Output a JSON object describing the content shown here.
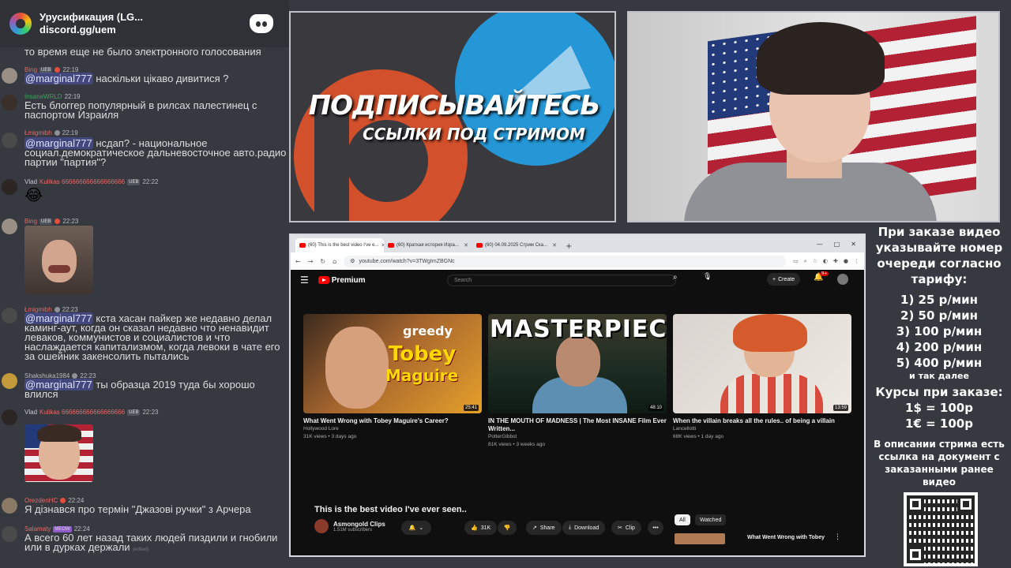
{
  "discord": {
    "server_name": "Урусификация (LG...",
    "invite": "discord.gg/uem",
    "messages": [
      {
        "kind": "text",
        "text": "то время еще не было электронного голосования"
      },
      {
        "kind": "msg",
        "user": "Bing",
        "user_color": "#e86a6a",
        "time": "22:19",
        "badge": "UEB",
        "mention": "@marginal777",
        "text": " наскільки цікаво дивитися ?"
      },
      {
        "kind": "msg",
        "user": "InsaneWRLD",
        "user_color": "#3ba55c",
        "time": "22:19",
        "text": "Есть блоггер популярный в рилсах палестинец с паспортом Израиля"
      },
      {
        "kind": "msg",
        "user": "Łmigmibh",
        "user_color": "#e86a6a",
        "time": "22:19",
        "mention": "@marginal777",
        "text": " нсдап? - национальное социал.демократическое дальневосточное авто.радио партии \"партия\"?"
      },
      {
        "kind": "msg",
        "user": "Vlad",
        "user_color": "#c9cdd2",
        "user_suffix": "Kulikas 666666666666666666",
        "time": "22:22",
        "badge": "UEB",
        "emoji": "😂"
      },
      {
        "kind": "msg",
        "user": "Bing",
        "user_color": "#e86a6a",
        "time": "22:23",
        "badge": "UEB",
        "image": "selfie-photo"
      },
      {
        "kind": "msg",
        "user": "Łmigmibh",
        "user_color": "#e86a6a",
        "time": "22:23",
        "mention": "@marginal777",
        "text": " кста хасан пайкер же недавно делал каминг-аут, когда он сказал недавно что ненавидит леваков, коммунистов и социалистов и что наслаждается капитализмом, когда левоки в чате его за ошейник закенсолить пытались"
      },
      {
        "kind": "msg",
        "user": "Shakshuka1984",
        "user_color": "#b9bbbe",
        "time": "22:23",
        "mention": "@marginal777",
        "text": " ты образца 2019 туда бы хорошо влился"
      },
      {
        "kind": "msg",
        "user": "Vlad",
        "user_color": "#c9cdd2",
        "user_suffix": "Kulikas 666666666666666666",
        "time": "22:23",
        "badge": "UEB",
        "image": "flag-selfie-photo"
      },
      {
        "kind": "msg",
        "user": "OrezdenHC",
        "user_color": "#e86a6a",
        "time": "22:24",
        "text": "Я дізнався про термін \"Джазові ручки\" з Арчера"
      },
      {
        "kind": "msg",
        "user": "Salamaty",
        "user_color": "#e86a6a",
        "time": "22:24",
        "badge": "MEOW",
        "text": "А всего 60 лет назад таких людей пиздили и гнобили или в дурках держали",
        "edited": "(edited)"
      }
    ]
  },
  "banner": {
    "title": "ПОДПИСЫВАЙТЕСЬ",
    "subtitle": "ССЫЛКИ ПОД СТРИМОМ"
  },
  "browser": {
    "tabs": [
      {
        "title": "(60) This is the best video I've e..."
      },
      {
        "title": "(60) Краткая история Изра..."
      },
      {
        "title": "(60) 04.09.2025 Стрим Ска..."
      }
    ],
    "url": "youtube.com/watch?v=3TWgImZBGNc",
    "youtube": {
      "logo": "Premium",
      "search_placeholder": "Search",
      "create_label": "Create",
      "notif_count": "9+",
      "videos": [
        {
          "title": "What Went Wrong with Tobey Maguire's Career?",
          "channel": "Hollywood Lore",
          "meta": "31K views • 3 days ago",
          "duration": "25:41",
          "thumb_words": [
            "greedy",
            "Tobey",
            "Maguire"
          ]
        },
        {
          "title": "IN THE MOUTH OF MADNESS | The Most INSANE Film Ever Written...",
          "channel": "PotterGibbst",
          "meta": "81K views • 3 weeks ago",
          "duration": "48:10",
          "thumb_words": [
            "MASTERPIECE"
          ]
        },
        {
          "title": "When the villain breaks all the rules.. of being a villain",
          "channel": "Lancellotti",
          "meta": "68K views • 1 day ago",
          "duration": "13:59",
          "thumb_words": []
        }
      ],
      "now_playing": {
        "title": "This is the best video I've ever seen..",
        "channel": "Asmongold Clips",
        "subscribers": "1.51M subscribers",
        "likes": "31K",
        "share": "Share",
        "download": "Download",
        "clip": "Clip",
        "more": "•••"
      },
      "chips": {
        "all": "All",
        "watched": "Watched"
      },
      "next_title": "What Went Wrong with Tobey"
    }
  },
  "pricing": {
    "intro": "При заказе видео указывайте номер очереди согласно тарифу:",
    "tariffs": [
      "1) 25 р/мин",
      "2) 50 р/мин",
      "3) 100 р/мин",
      "4) 200 р/мин",
      "5) 400 р/мин"
    ],
    "etc": "и так далее",
    "rates_title": "Курсы при заказе:",
    "rates": [
      "1$ = 100р",
      "1€ = 100р"
    ],
    "note": "В описании стрима есть ссылка на документ с заказанными ранее видео"
  }
}
